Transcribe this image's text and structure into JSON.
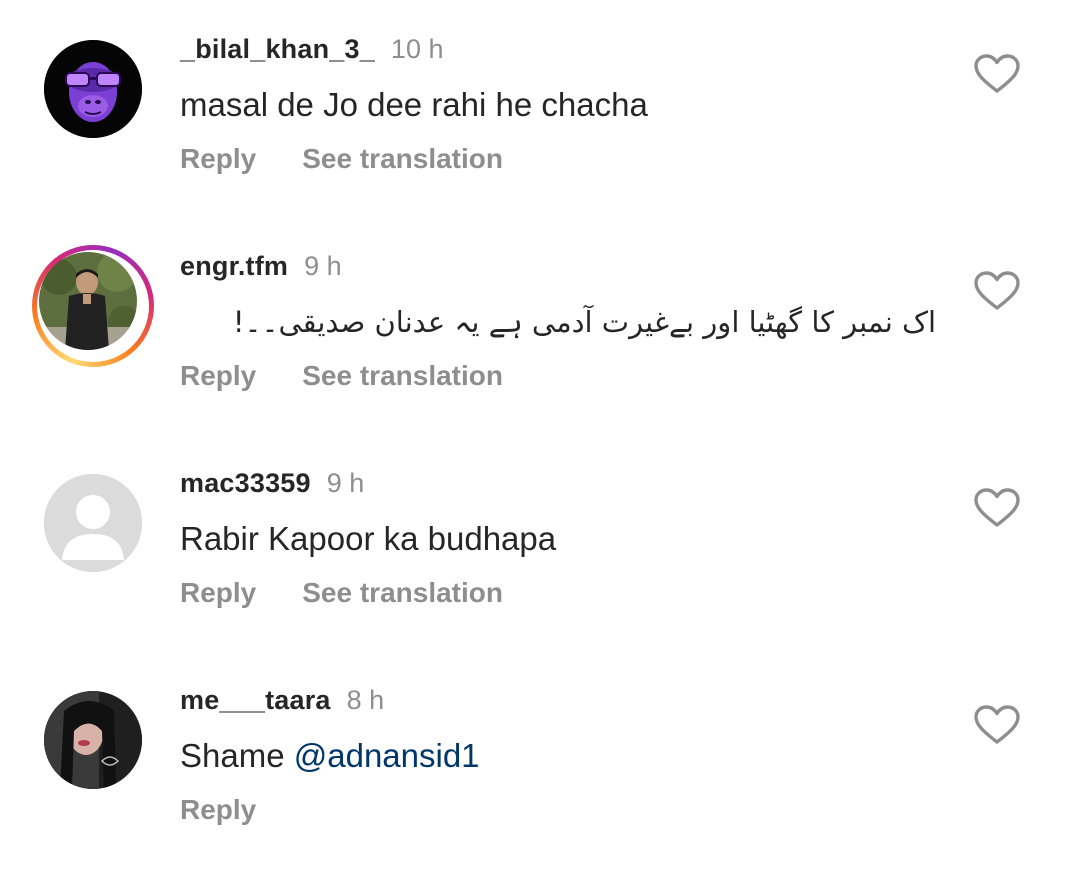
{
  "comments": [
    {
      "username": "_bilal_khan_3_",
      "time": "10 h",
      "text": "masal de Jo dee rahi he chacha",
      "reply_label": "Reply",
      "translate_label": "See translation"
    },
    {
      "username": "engr.tfm",
      "time": "9 h",
      "text": "اک نمبر کا گھٹیا اور بےغیرت آدمی ہے یہ عدنان صدیقی۔۔!",
      "reply_label": "Reply",
      "translate_label": "See translation"
    },
    {
      "username": "mac33359",
      "time": "9 h",
      "text": "Rabir Kapoor ka budhapa",
      "reply_label": "Reply",
      "translate_label": "See translation"
    },
    {
      "username": "me___taara",
      "time": "8 h",
      "text_prefix": "Shame ",
      "mention": "@adnansid1",
      "reply_label": "Reply"
    }
  ],
  "icons": {
    "like": "heart-outline-icon",
    "default_avatar": "default-user-icon"
  },
  "colors": {
    "username": "#262626",
    "secondary": "#8e8e8e",
    "mention": "#00376b",
    "story_ring": [
      "#feda75",
      "#fa7e1e",
      "#d62976",
      "#962fbf"
    ]
  }
}
